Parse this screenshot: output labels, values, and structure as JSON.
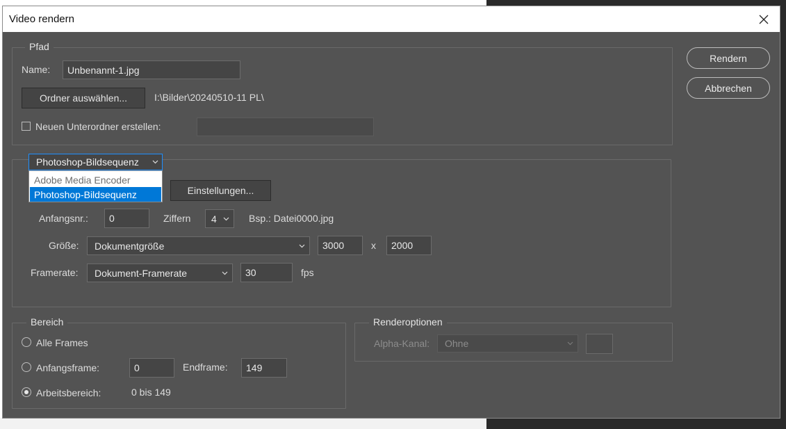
{
  "window": {
    "title": "Video rendern"
  },
  "actions": {
    "render_label": "Rendern",
    "cancel_label": "Abbrechen"
  },
  "path_group": {
    "legend": "Pfad",
    "name_label": "Name:",
    "name_value": "Unbenannt-1.jpg",
    "select_folder_label": "Ordner auswählen...",
    "folder_path": "I:\\Bilder\\20240510-11 PL\\",
    "subfolder_label": "Neuen Unterordner erstellen:",
    "subfolder_value": ""
  },
  "format": {
    "selected": "Photoshop-Bildsequenz",
    "options": [
      "Adobe Media Encoder",
      "Photoshop-Bildsequenz"
    ],
    "settings_label": "Einstellungen...",
    "start_number_label": "Anfangsnr.:",
    "start_number_value": "0",
    "digits_label": "Ziffern",
    "digits_value": "4",
    "example_label": "Bsp.: Datei0000.jpg",
    "size_label": "Größe:",
    "size_value": "Dokumentgröße",
    "width_value": "3000",
    "x_label": "x",
    "height_value": "2000",
    "framerate_label": "Framerate:",
    "framerate_value": "Dokument-Framerate",
    "fps_value": "30",
    "fps_label": "fps"
  },
  "range": {
    "legend": "Bereich",
    "all_frames_label": "Alle Frames",
    "start_frame_label": "Anfangsframe:",
    "start_frame_value": "0",
    "end_frame_label": "Endframe:",
    "end_frame_value": "149",
    "work_area_label": "Arbeitsbereich:",
    "work_area_value": "0 bis 149",
    "selected": "work_area"
  },
  "render_options": {
    "legend": "Renderoptionen",
    "alpha_label": "Alpha-Kanal:",
    "alpha_value": "Ohne"
  },
  "colors": {
    "dialog_bg": "#535353",
    "selection_blue": "#0078d7",
    "focus_blue": "#1e8fff"
  }
}
